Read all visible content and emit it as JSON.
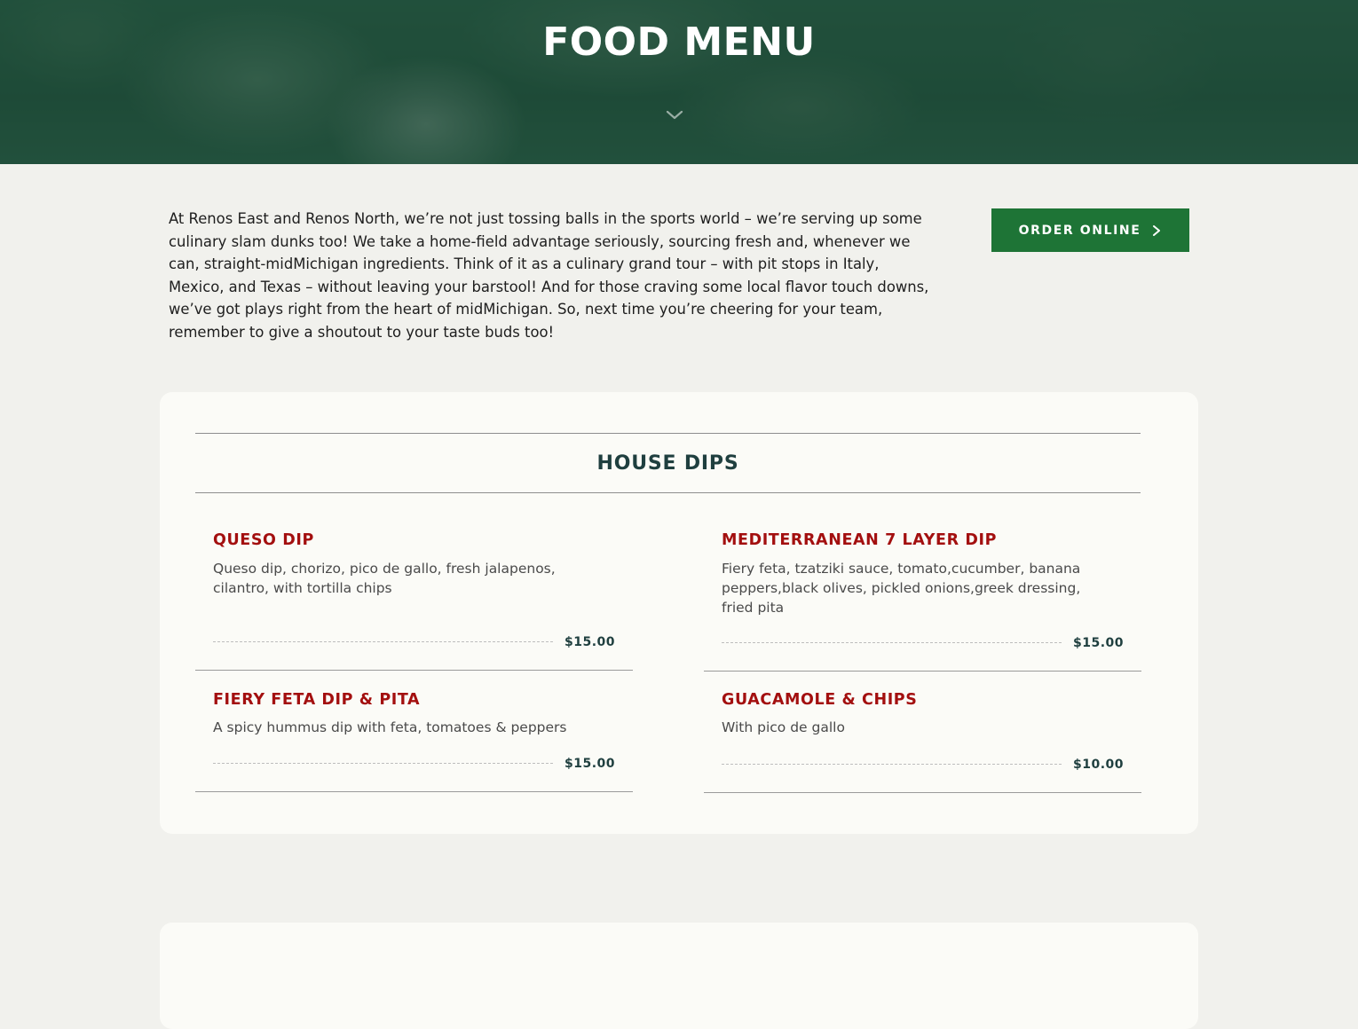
{
  "hero": {
    "title": "FOOD MENU",
    "scroll_icon": "chevron-down-icon"
  },
  "intro": {
    "text": "At Renos East and Renos North, we’re not just tossing balls in the sports world – we’re serving up some culinary slam dunks too! We take a home-field advantage seriously, sourcing fresh and, whenever we can, straight-midMichigan ingredients. Think of it as a culinary grand tour – with pit stops in Italy, Mexico, and Texas – without leaving your barstool! And for those craving some local flavor touch downs, we’ve got plays right from the heart of midMichigan. So, next time you’re cheering for your team, remember to give a shoutout to your taste buds too!"
  },
  "order_button": {
    "label": "ORDER ONLINE",
    "icon": "chevron-right-icon"
  },
  "section": {
    "title": "HOUSE DIPS",
    "items": [
      {
        "name": "QUESO DIP",
        "description": "Queso dip, chorizo, pico de gallo, fresh jalapenos, cilantro, with tortilla chips",
        "price": "$15.00"
      },
      {
        "name": "MEDITERRANEAN 7 LAYER DIP",
        "description": "Fiery feta, tzatziki sauce, tomato,cucumber, banana peppers,black olives, pickled onions,greek dressing, fried pita",
        "price": "$15.00"
      },
      {
        "name": "FIERY FETA DIP & PITA",
        "description": "A spicy hummus dip with feta, tomatoes & peppers",
        "price": "$15.00"
      },
      {
        "name": "GUACAMOLE & CHIPS",
        "description": "With pico de gallo",
        "price": "$10.00"
      }
    ]
  },
  "colors": {
    "brand_green": "#1e7436",
    "item_red": "#a30f0f",
    "heading_teal": "#1f3f3f",
    "page_bg": "#f1f1ed",
    "card_bg": "#fbfbf7"
  }
}
